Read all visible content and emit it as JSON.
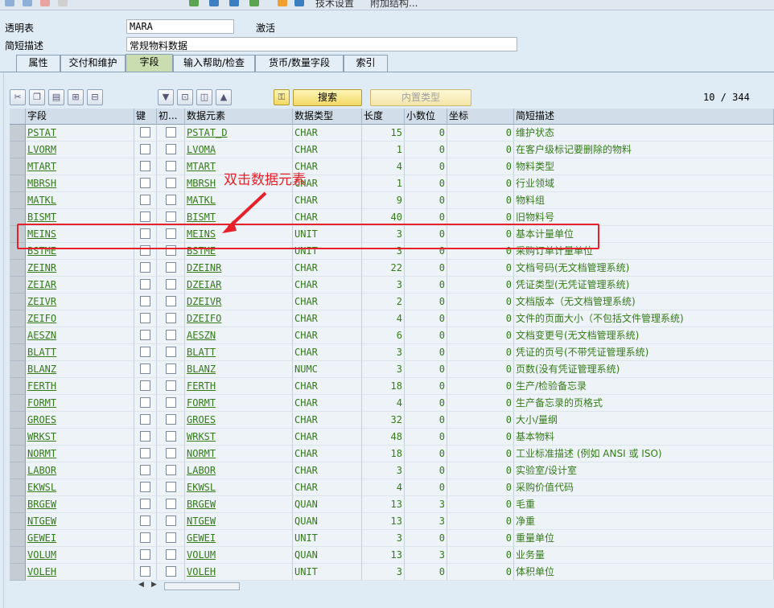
{
  "toolbar_top": {
    "label_1": "技术设置",
    "label_2": "附加结构..."
  },
  "header": {
    "transparent_table_label": "透明表",
    "transparent_table_value": "MARA",
    "status": "激活",
    "short_desc_label": "简短描述",
    "short_desc_value": "常规物料数据"
  },
  "tabs": [
    "属性",
    "交付和维护",
    "字段",
    "输入帮助/检查",
    "货币/数量字段",
    "索引"
  ],
  "active_tab": "字段",
  "buttons": {
    "search": "搜索",
    "builtin_type": "内置类型"
  },
  "counter": "10 / 344",
  "columns": [
    "字段",
    "键",
    "初...",
    "数据元素",
    "数据类型",
    "长度",
    "小数位",
    "坐标",
    "简短描述"
  ],
  "rows": [
    {
      "field": "PSTAT",
      "key": false,
      "init": false,
      "dataelement": "PSTAT_D",
      "datatype": "CHAR",
      "length": "15",
      "decimals": "0",
      "coord": "0",
      "desc": "维护状态"
    },
    {
      "field": "LVORM",
      "key": false,
      "init": false,
      "dataelement": "LVOMA",
      "datatype": "CHAR",
      "length": "1",
      "decimals": "0",
      "coord": "0",
      "desc": "在客户级标记要删除的物料"
    },
    {
      "field": "MTART",
      "key": false,
      "init": false,
      "dataelement": "MTART",
      "datatype": "CHAR",
      "length": "4",
      "decimals": "0",
      "coord": "0",
      "desc": "物料类型"
    },
    {
      "field": "MBRSH",
      "key": false,
      "init": false,
      "dataelement": "MBRSH",
      "datatype": "CHAR",
      "length": "1",
      "decimals": "0",
      "coord": "0",
      "desc": "行业领域"
    },
    {
      "field": "MATKL",
      "key": false,
      "init": false,
      "dataelement": "MATKL",
      "datatype": "CHAR",
      "length": "9",
      "decimals": "0",
      "coord": "0",
      "desc": "物料组"
    },
    {
      "field": "BISMT",
      "key": false,
      "init": false,
      "dataelement": "BISMT",
      "datatype": "CHAR",
      "length": "40",
      "decimals": "0",
      "coord": "0",
      "desc": "旧物料号"
    },
    {
      "field": "MEINS",
      "key": false,
      "init": false,
      "dataelement": "MEINS",
      "datatype": "UNIT",
      "length": "3",
      "decimals": "0",
      "coord": "0",
      "desc": "基本计量单位"
    },
    {
      "field": "BSTME",
      "key": false,
      "init": false,
      "dataelement": "BSTME",
      "datatype": "UNIT",
      "length": "3",
      "decimals": "0",
      "coord": "0",
      "desc": "采购订单计量单位"
    },
    {
      "field": "ZEINR",
      "key": false,
      "init": false,
      "dataelement": "DZEINR",
      "datatype": "CHAR",
      "length": "22",
      "decimals": "0",
      "coord": "0",
      "desc": "文档号码(无文档管理系统)"
    },
    {
      "field": "ZEIAR",
      "key": false,
      "init": false,
      "dataelement": "DZEIAR",
      "datatype": "CHAR",
      "length": "3",
      "decimals": "0",
      "coord": "0",
      "desc": "凭证类型(无凭证管理系统)"
    },
    {
      "field": "ZEIVR",
      "key": false,
      "init": false,
      "dataelement": "DZEIVR",
      "datatype": "CHAR",
      "length": "2",
      "decimals": "0",
      "coord": "0",
      "desc": "文档版本（无文档管理系统)"
    },
    {
      "field": "ZEIFO",
      "key": false,
      "init": false,
      "dataelement": "DZEIFO",
      "datatype": "CHAR",
      "length": "4",
      "decimals": "0",
      "coord": "0",
      "desc": "文件的页面大小（不包括文件管理系统)"
    },
    {
      "field": "AESZN",
      "key": false,
      "init": false,
      "dataelement": "AESZN",
      "datatype": "CHAR",
      "length": "6",
      "decimals": "0",
      "coord": "0",
      "desc": "文档变更号(无文档管理系统)"
    },
    {
      "field": "BLATT",
      "key": false,
      "init": false,
      "dataelement": "BLATT",
      "datatype": "CHAR",
      "length": "3",
      "decimals": "0",
      "coord": "0",
      "desc": "凭证的页号(不带凭证管理系统)"
    },
    {
      "field": "BLANZ",
      "key": false,
      "init": false,
      "dataelement": "BLANZ",
      "datatype": "NUMC",
      "length": "3",
      "decimals": "0",
      "coord": "0",
      "desc": "页数(没有凭证管理系统)"
    },
    {
      "field": "FERTH",
      "key": false,
      "init": false,
      "dataelement": "FERTH",
      "datatype": "CHAR",
      "length": "18",
      "decimals": "0",
      "coord": "0",
      "desc": "生产/检验备忘录"
    },
    {
      "field": "FORMT",
      "key": false,
      "init": false,
      "dataelement": "FORMT",
      "datatype": "CHAR",
      "length": "4",
      "decimals": "0",
      "coord": "0",
      "desc": "生产备忘录的页格式"
    },
    {
      "field": "GROES",
      "key": false,
      "init": false,
      "dataelement": "GROES",
      "datatype": "CHAR",
      "length": "32",
      "decimals": "0",
      "coord": "0",
      "desc": "大小/量纲"
    },
    {
      "field": "WRKST",
      "key": false,
      "init": false,
      "dataelement": "WRKST",
      "datatype": "CHAR",
      "length": "48",
      "decimals": "0",
      "coord": "0",
      "desc": "基本物料"
    },
    {
      "field": "NORMT",
      "key": false,
      "init": false,
      "dataelement": "NORMT",
      "datatype": "CHAR",
      "length": "18",
      "decimals": "0",
      "coord": "0",
      "desc": "工业标准描述 (例如 ANSI 或 ISO)"
    },
    {
      "field": "LABOR",
      "key": false,
      "init": false,
      "dataelement": "LABOR",
      "datatype": "CHAR",
      "length": "3",
      "decimals": "0",
      "coord": "0",
      "desc": "实验室/设计室"
    },
    {
      "field": "EKWSL",
      "key": false,
      "init": false,
      "dataelement": "EKWSL",
      "datatype": "CHAR",
      "length": "4",
      "decimals": "0",
      "coord": "0",
      "desc": "采购价值代码"
    },
    {
      "field": "BRGEW",
      "key": false,
      "init": false,
      "dataelement": "BRGEW",
      "datatype": "QUAN",
      "length": "13",
      "decimals": "3",
      "coord": "0",
      "desc": "毛重"
    },
    {
      "field": "NTGEW",
      "key": false,
      "init": false,
      "dataelement": "NTGEW",
      "datatype": "QUAN",
      "length": "13",
      "decimals": "3",
      "coord": "0",
      "desc": "净重"
    },
    {
      "field": "GEWEI",
      "key": false,
      "init": false,
      "dataelement": "GEWEI",
      "datatype": "UNIT",
      "length": "3",
      "decimals": "0",
      "coord": "0",
      "desc": "重量单位"
    },
    {
      "field": "VOLUM",
      "key": false,
      "init": false,
      "dataelement": "VOLUM",
      "datatype": "QUAN",
      "length": "13",
      "decimals": "3",
      "coord": "0",
      "desc": "业务量"
    },
    {
      "field": "VOLEH",
      "key": false,
      "init": false,
      "dataelement": "VOLEH",
      "datatype": "UNIT",
      "length": "3",
      "decimals": "0",
      "coord": "0",
      "desc": "体积单位"
    }
  ],
  "annotation": {
    "text": "双击数据元素",
    "color": "#e8202a"
  },
  "colors": {
    "link_green": "#357a1a",
    "active_tab": "#c9ddb1",
    "background": "#dfebf5"
  }
}
